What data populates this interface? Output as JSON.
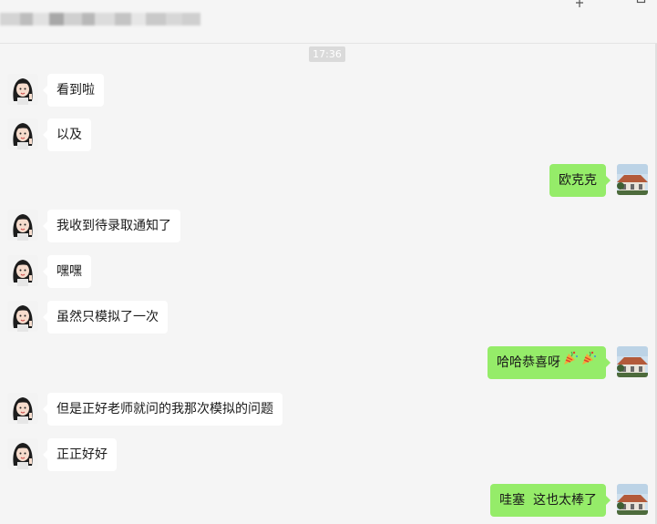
{
  "window": {
    "controls": {
      "pin_icon": "pin-icon",
      "minimize_icon": "minimize-icon",
      "maximize_icon": "maximize-icon"
    }
  },
  "timestamp": "17:36",
  "messages": [
    {
      "side": "left",
      "text": "看到啦"
    },
    {
      "side": "left",
      "text": "以及"
    },
    {
      "side": "right",
      "text": "欧克克"
    },
    {
      "side": "left",
      "text": "我收到待录取通知了"
    },
    {
      "side": "left",
      "text": "嘿嘿"
    },
    {
      "side": "left",
      "text": "虽然只模拟了一次"
    },
    {
      "side": "right",
      "text": "哈哈恭喜呀",
      "emoji": [
        "party-popper-icon",
        "party-popper-icon"
      ]
    },
    {
      "side": "left",
      "text": "但是正好老师就问的我那次模拟的问题"
    },
    {
      "side": "left",
      "text": "正正好好"
    },
    {
      "side": "right",
      "text": "哇塞  这也太棒了"
    }
  ],
  "colors": {
    "background": "#f5f5f5",
    "incoming_bubble": "#ffffff",
    "outgoing_bubble": "#95ec69",
    "timestamp_bg": "#dadada"
  }
}
